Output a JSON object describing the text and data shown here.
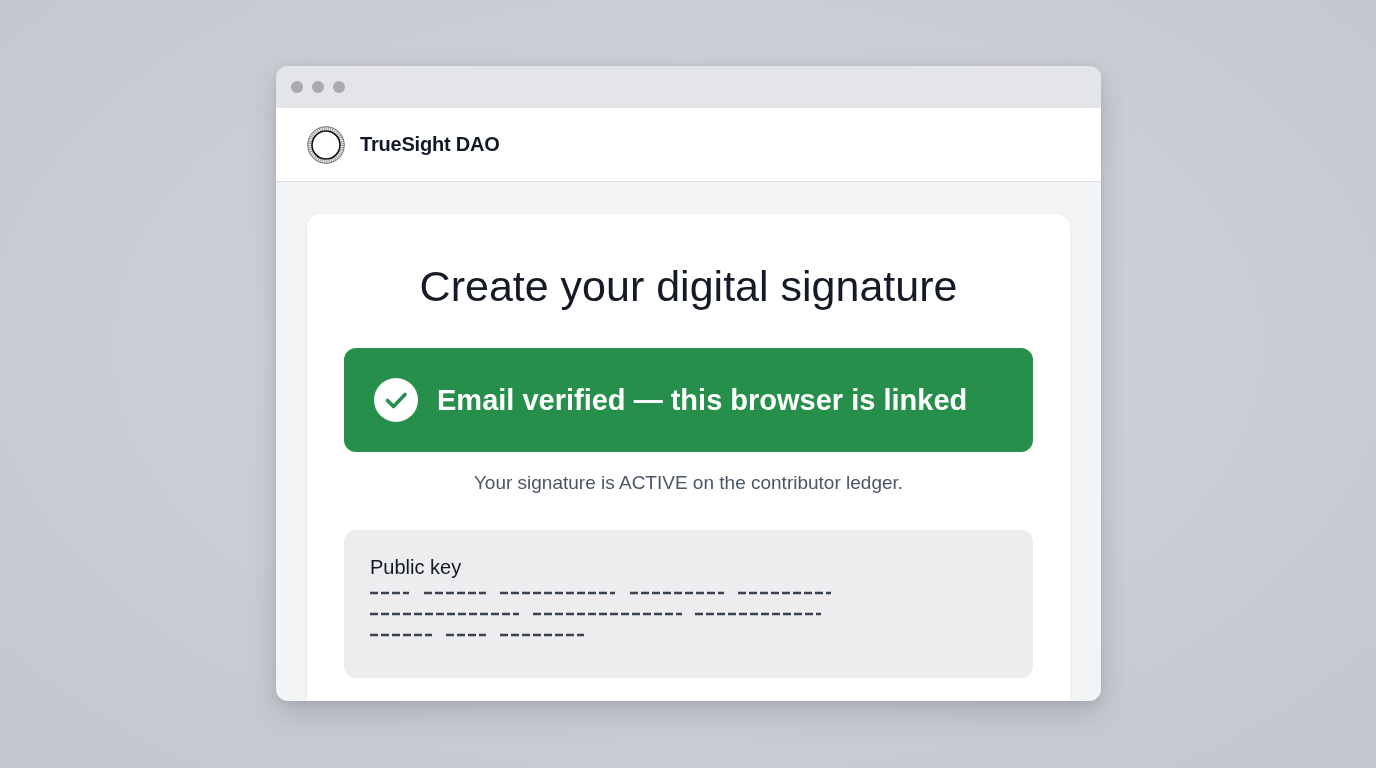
{
  "header": {
    "brand": "TrueSight DAO"
  },
  "card": {
    "title": "Create your digital signature",
    "banner": {
      "text": "Email verified — this browser is linked"
    },
    "status_text": "Your signature is ACTIVE on the contributor ledger.",
    "key_panel": {
      "label": "Public key"
    }
  }
}
